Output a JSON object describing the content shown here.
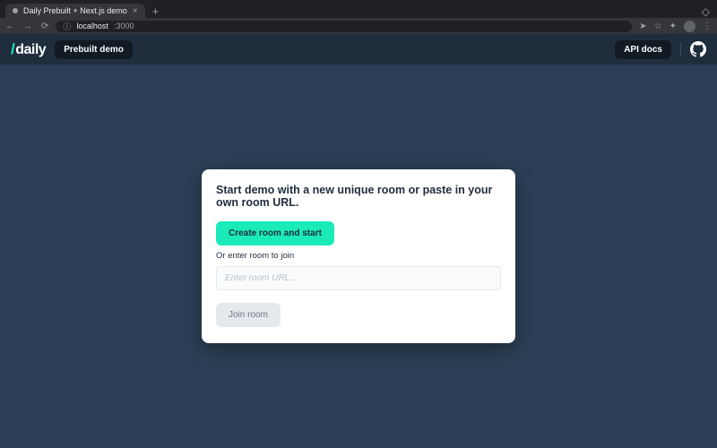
{
  "browser": {
    "tab_title": "Daily Prebuilt + Next.js demo",
    "url_host": "localhost",
    "url_port": ":3000"
  },
  "header": {
    "logo_text": "daily",
    "badge": "Prebuilt demo",
    "api_docs": "API docs"
  },
  "card": {
    "heading": "Start demo with a new unique room or paste in your own room URL.",
    "create_btn": "Create room and start",
    "or_text": "Or enter room to join",
    "input_placeholder": "Enter room URL...",
    "join_btn": "Join room"
  }
}
